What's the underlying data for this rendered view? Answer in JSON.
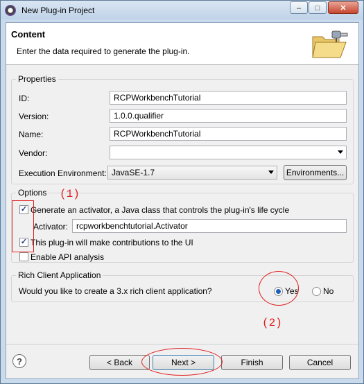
{
  "window": {
    "title": "New Plug-in Project",
    "min_label": "‒",
    "max_label": "□",
    "close_label": "✕"
  },
  "header": {
    "title": "Content",
    "description": "Enter the data required to generate the plug-in."
  },
  "properties": {
    "legend": "Properties",
    "id": {
      "label": "ID:",
      "value": "RCPWorkbenchTutorial"
    },
    "version": {
      "label": "Version:",
      "value": "1.0.0.qualifier"
    },
    "name": {
      "label": "Name:",
      "value": "RCPWorkbenchTutorial"
    },
    "vendor": {
      "label": "Vendor:",
      "value": ""
    },
    "exec_env": {
      "label": "Execution Environment:",
      "value": "JavaSE-1.7",
      "button": "Environments..."
    }
  },
  "options": {
    "legend": "Options",
    "generate_activator": {
      "label": "Generate an activator, a Java class that controls the plug-in's life cycle",
      "checked": true
    },
    "activator": {
      "label": "Activator:",
      "value": "rcpworkbenchtutorial.Activator"
    },
    "ui_contrib": {
      "label": "This plug-in will make contributions to the UI",
      "checked": true
    },
    "api_analysis": {
      "label": "Enable API analysis",
      "checked": false
    }
  },
  "rca": {
    "legend": "Rich Client Application",
    "question": "Would you like to create a 3.x rich client application?",
    "yes": "Yes",
    "no": "No",
    "selected": "Yes"
  },
  "buttons": {
    "help": "?",
    "back": "< Back",
    "next": "Next >",
    "finish": "Finish",
    "cancel": "Cancel"
  },
  "annotations": {
    "one": "(1)",
    "two": "(2)",
    "color": "#e02020"
  },
  "icons": {
    "app": "eclipse-icon",
    "header": "folder-plug-icon",
    "help": "help-icon"
  }
}
